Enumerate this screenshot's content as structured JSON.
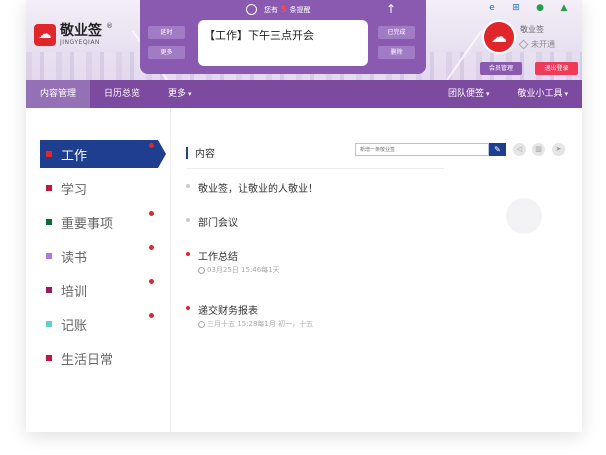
{
  "logo": {
    "name": "敬业签",
    "subtitle": "JINGYEQIAN",
    "reg": "®"
  },
  "notice": {
    "prefix": "您有",
    "count": "5",
    "suffix": "条提醒",
    "current_note": "【工作】下午三点开会",
    "left_buttons": [
      "延时",
      "更多"
    ],
    "right_buttons": [
      "已完成",
      "删除"
    ]
  },
  "platforms": [
    "ie-icon",
    "windows-icon",
    "apple-icon",
    "android-icon"
  ],
  "user": {
    "name": "敬业签",
    "status": "未开通"
  },
  "header_buttons": {
    "member": "会员管理",
    "logout": "退出登录"
  },
  "nav": {
    "left": [
      {
        "label": "内容管理",
        "active": true
      },
      {
        "label": "日历总览",
        "active": false
      },
      {
        "label": "更多",
        "caret": "▾"
      }
    ],
    "right": [
      {
        "label": "团队便签",
        "caret": "▾"
      },
      {
        "label": "敬业小工具",
        "caret": "▾"
      }
    ]
  },
  "categories": [
    {
      "label": "工作",
      "color": "#e0262b",
      "active": true,
      "dot": true
    },
    {
      "label": "学习",
      "color": "#c0173a",
      "active": false,
      "dot": false
    },
    {
      "label": "重要事项",
      "color": "#0d6b3a",
      "active": false,
      "dot": true
    },
    {
      "label": "读书",
      "color": "#a77be0",
      "active": false,
      "dot": true
    },
    {
      "label": "培训",
      "color": "#9a1a5a",
      "active": false,
      "dot": true
    },
    {
      "label": "记账",
      "color": "#5ed0d0",
      "active": false,
      "dot": true
    },
    {
      "label": "生活日常",
      "color": "#c0173a",
      "active": false,
      "dot": false
    }
  ],
  "content": {
    "title": "内容",
    "new_placeholder": "新增一条敬业签",
    "items": [
      {
        "text": "敬业签，让敬业的人敬业！",
        "meta": "",
        "reminder": false
      },
      {
        "text": "部门会议",
        "meta": "",
        "reminder": false
      },
      {
        "text": "工作总结",
        "meta": "03月25日 15:46每1天",
        "reminder": true
      },
      {
        "text": "递交财务报表",
        "meta": "三月十五 15:28每1月 初一，十五",
        "reminder": true
      }
    ]
  },
  "colors": {
    "brand_red": "#e0262b",
    "nav_purple": "#7c4a9e",
    "active_blue": "#1e3f8f"
  }
}
